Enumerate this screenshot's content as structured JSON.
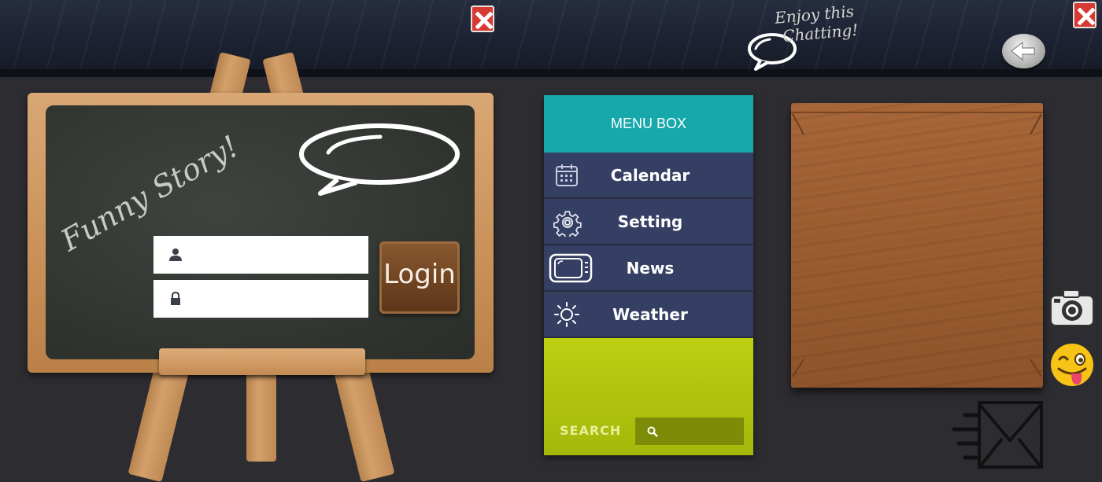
{
  "header": {
    "chat_text_line1": "Enjoy this",
    "chat_text_line2": "Chatting!"
  },
  "chalkboard": {
    "title": "Funny Story!",
    "username_placeholder": "",
    "password_placeholder": "",
    "login_label": "Login"
  },
  "menu": {
    "title": "MENU BOX",
    "items": [
      {
        "label": "Calendar",
        "icon": "calendar-icon"
      },
      {
        "label": "Setting",
        "icon": "gear-icon"
      },
      {
        "label": "News",
        "icon": "tv-icon"
      },
      {
        "label": "Weather",
        "icon": "sun-icon"
      }
    ],
    "search_label": "SEARCH",
    "search_placeholder": ""
  },
  "colors": {
    "menu_header": "#16a8ab",
    "menu_item": "#353e63",
    "menu_green": "#b3c70f",
    "close_red": "#d63a33"
  }
}
